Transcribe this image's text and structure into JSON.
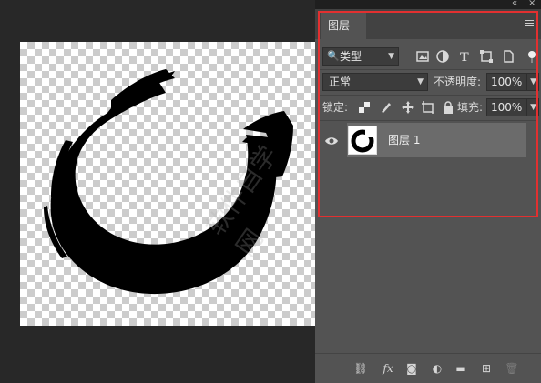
{
  "panel": {
    "tab_label": "图层",
    "filter": {
      "label": "类型",
      "icons": [
        "image-filter-icon",
        "adjustment-filter-icon",
        "type-filter-icon",
        "shape-filter-icon",
        "smart-object-filter-icon"
      ]
    },
    "blend_mode": "正常",
    "opacity_label": "不透明度:",
    "opacity_value": "100%",
    "lock_label": "锁定:",
    "fill_label": "填充:",
    "fill_value": "100%",
    "layers": [
      {
        "name": "图层 1",
        "visible": true,
        "selected": true
      }
    ],
    "footer_icons": [
      "link-icon",
      "fx-icon",
      "mask-icon",
      "adjustment-icon",
      "folder-icon",
      "new-layer-icon",
      "trash-icon"
    ]
  },
  "watermark": {
    "text": "软件自学网",
    "url": "WWW.RJZXW.COM"
  },
  "colors": {
    "highlight": "#e23030",
    "panel": "#535353",
    "selected_row": "#6b6b6b"
  }
}
